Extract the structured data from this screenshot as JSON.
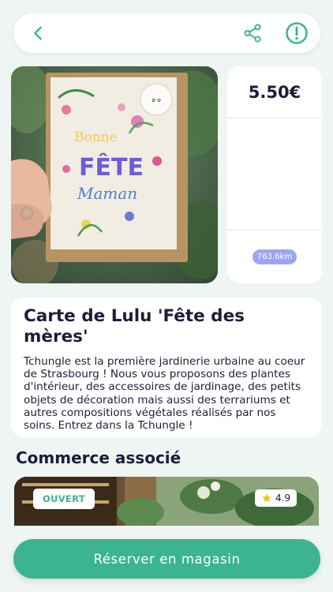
{
  "header": {
    "back_icon": "chevron-left-icon",
    "share_icon": "share-icon",
    "report_icon": "alert-circle-icon",
    "accent_color": "#3cb48f"
  },
  "product": {
    "price": "5.50€",
    "distance": "763.6km",
    "title": "Carte de Lulu 'Fête des mères'",
    "description": "Tchungle est la première jardinerie urbaine au coeur de Strasbourg ! Nous vous proposons des plantes d'intérieur, des accessoires de jardinage, des petits objets de décoration mais aussi des terrariums et autres compositions végétales réalisés par nos soins. Entrez dans la Tchungle !",
    "card_text": {
      "line1": "Bonne",
      "line2": "FÊTE",
      "line3": "Maman"
    }
  },
  "shop_section": {
    "title": "Commerce associé",
    "status": "OUVERT",
    "rating": "4.9",
    "status_color": "#3cb48f",
    "star_color": "#f5c518"
  },
  "cta": {
    "reserve_label": "Réserver en magasin"
  }
}
